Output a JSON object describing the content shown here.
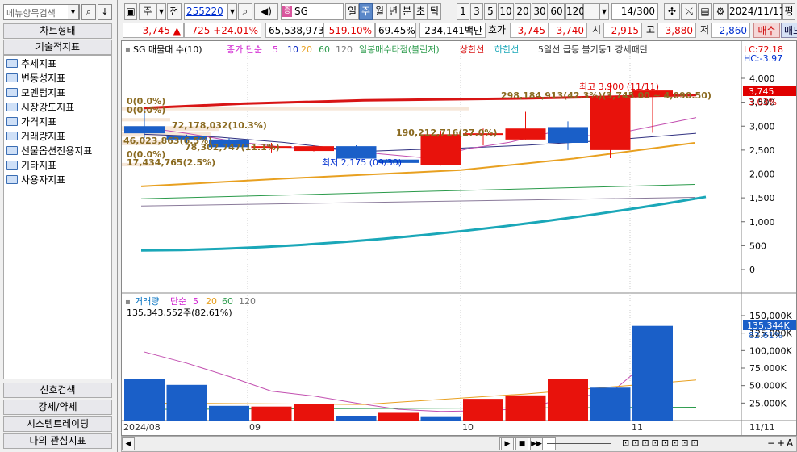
{
  "left_panel": {
    "search_placeholder": "메뉴항목검색",
    "chart_type_tab": "차트형태",
    "tech_tab": "기술적지표",
    "tree_items": [
      "추세지표",
      "변동성지표",
      "모멘텀지표",
      "시장강도지표",
      "가격지표",
      "거래량지표",
      "선물옵션전용지표",
      "기타지표",
      "사용자지표"
    ],
    "bottom_tabs": [
      "신호검색",
      "강세/약세",
      "시스템트레이딩",
      "나의 관심지표"
    ]
  },
  "toolbar": {
    "period_label": "주",
    "prev_label": "전",
    "code": "255220",
    "stock_name": "SG",
    "period_tabs": [
      "일",
      "주",
      "월",
      "년",
      "분",
      "초",
      "틱"
    ],
    "active_period": "주",
    "intervals": [
      "1",
      "3",
      "5",
      "10",
      "20",
      "30",
      "60",
      "120"
    ],
    "page_count": "14/300",
    "date": "2024/11/11",
    "tail_label": "평"
  },
  "quote": {
    "price": "3,745",
    "change": "725",
    "change_pct": "+24.01%",
    "volume": "65,538,973",
    "vol_ratio": "519.10%",
    "turnover_ratio": "69.45%",
    "amount": "234,141백만",
    "hoga_label": "호가",
    "ask": "3,745",
    "bid": "3,740",
    "open_label": "시",
    "open": "2,915",
    "high_label": "고",
    "high": "3,880",
    "low_label": "저",
    "low": "2,860",
    "buy_btn": "매수",
    "sell_btn": "매도"
  },
  "price_pane": {
    "legend": [
      "SG 매물대 수(10)",
      "종가 단순",
      "5",
      "10",
      "20",
      "60",
      "120",
      "일봉매수타점(볼린저)",
      "상한선",
      "하한선",
      "5일선 급등 불기둥1 강세패턴"
    ],
    "lc": "LC:72.18",
    "hc": "HC:-3.97",
    "axis_ticks": [
      "4,000",
      "3,500",
      "3,000",
      "2,500",
      "2,000",
      "1,500",
      "1,000",
      "500",
      "0"
    ],
    "price_label": "3,745",
    "price_pct": "3.03%",
    "annotations": {
      "high": "최고 3,900 (11/11)",
      "low": "최저 2,175 (09/30)",
      "vp1": "0(0.0%)",
      "vp2": "72,178,032(10.3%)",
      "vp3": "46,023,863(6.5%)",
      "vp4": "78,302,747(11.1%)",
      "vp5": "0(0.0%)",
      "vp6": "17,434,765(2.5%)",
      "vp7": "190,212,716(27.0%)",
      "vp8": "298,184,913(42.3%)(3,745.00 ~ 4,090.50)",
      "vp0": "0(0.0%)"
    },
    "colors": {
      "up": "#e8120c",
      "down": "#1a5fc8"
    }
  },
  "volume_pane": {
    "legend": [
      "거래량",
      "단순",
      "5",
      "20",
      "60",
      "120"
    ],
    "info": "135,343,552주(82.61%)",
    "axis_ticks": [
      "150,000K",
      "125,000K",
      "100,000K",
      "75,000K",
      "50,000K",
      "25,000K"
    ],
    "vol_label": "135,344K",
    "vol_pct": "82.61%"
  },
  "x_axis": {
    "labels": [
      "2024/08",
      "09",
      "10",
      "11"
    ],
    "right_label": "11/11"
  },
  "chart_data": {
    "type": "candlestick",
    "candles": [
      {
        "open": 3000,
        "close": 2850,
        "high": 3350,
        "low": 2750,
        "dir": "down"
      },
      {
        "open": 2800,
        "close": 2720,
        "high": 2820,
        "low": 2650,
        "dir": "down"
      },
      {
        "open": 2720,
        "close": 2560,
        "high": 2750,
        "low": 2520,
        "dir": "down"
      },
      {
        "open": 2560,
        "close": 2580,
        "high": 2650,
        "low": 2450,
        "dir": "up"
      },
      {
        "open": 2480,
        "close": 2580,
        "high": 2600,
        "low": 2470,
        "dir": "up"
      },
      {
        "open": 2580,
        "close": 2320,
        "high": 2600,
        "low": 2300,
        "dir": "down"
      },
      {
        "open": 2300,
        "close": 2230,
        "high": 2300,
        "low": 2175,
        "dir": "down"
      },
      {
        "open": 2180,
        "close": 2830,
        "high": 2900,
        "low": 2175,
        "dir": "up"
      },
      {
        "open": 2830,
        "close": 2850,
        "high": 2950,
        "low": 2600,
        "dir": "up"
      },
      {
        "open": 2720,
        "close": 2950,
        "high": 3300,
        "low": 2720,
        "dir": "up"
      },
      {
        "open": 2980,
        "close": 2650,
        "high": 3100,
        "low": 2500,
        "dir": "down"
      },
      {
        "open": 2500,
        "close": 3620,
        "high": 3900,
        "low": 2330,
        "dir": "up"
      },
      {
        "open": 3620,
        "close": 3745,
        "high": 3880,
        "low": 2860,
        "dir": "up"
      }
    ],
    "volumes": [
      59000,
      51000,
      21000,
      20000,
      24000,
      6000,
      11000,
      5000,
      31000,
      36000,
      59000,
      47000,
      135344
    ],
    "vol_dirs": [
      "down",
      "down",
      "down",
      "up",
      "up",
      "down",
      "up",
      "down",
      "up",
      "up",
      "up",
      "down",
      "down"
    ],
    "ma_volume": [
      98000,
      82000,
      63000,
      42000,
      35000,
      25000,
      16000,
      13000,
      14000,
      17000,
      33000,
      39000,
      90000
    ],
    "ylim_price": [
      0,
      4100
    ],
    "ylim_volume": [
      0,
      165000
    ]
  }
}
